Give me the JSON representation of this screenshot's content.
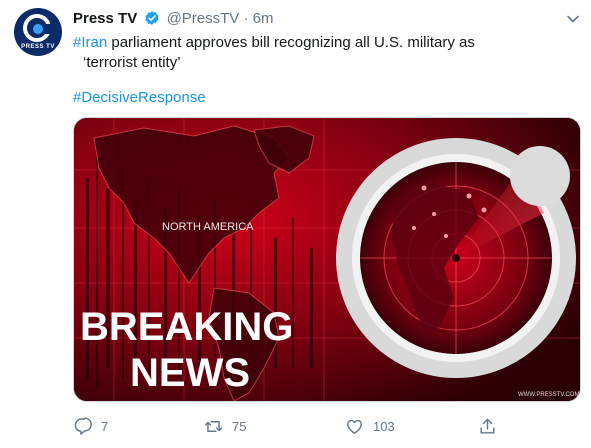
{
  "tweet": {
    "display_name": "Press TV",
    "handle": "@PressTV",
    "separator": "·",
    "time": "6m",
    "hashtag": "#Iran",
    "text_line1": " parliament approves bill recognizing all U.S. military as",
    "text_line2": "‘terrorist entity’",
    "hashtag2": "#DecisiveResponse"
  },
  "avatar": {
    "label": "PRESS TV"
  },
  "media": {
    "headline_line1": "BREAKING",
    "headline_line2": "NEWS",
    "map_label": "NORTH AMERICA",
    "watermark": "WWW.PRESSTV.COM"
  },
  "actions": {
    "reply_count": "7",
    "retweet_count": "75",
    "like_count": "103"
  },
  "colors": {
    "accent": "#1b95e0",
    "verified": "#1da1f2",
    "secondary_text": "#657786"
  },
  "icons": [
    "reply-icon",
    "retweet-icon",
    "like-icon",
    "share-icon",
    "verified-icon",
    "chevron-down-icon"
  ]
}
